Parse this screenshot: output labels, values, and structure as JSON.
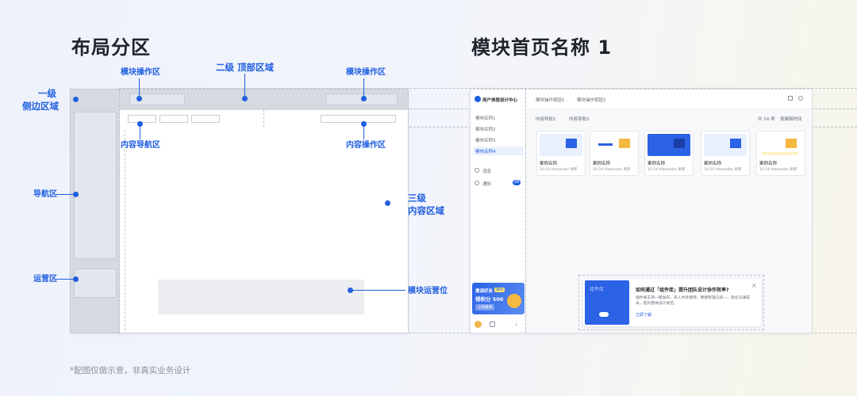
{
  "titles": {
    "layout": "布局分区",
    "module_home": "模块首页名称 1"
  },
  "labels": {
    "level1_a": "一级",
    "level1_b": "侧边区域",
    "level2": "二级 顶部区域",
    "level3_a": "三级",
    "level3_b": "内容区域",
    "module_ops_left": "模块操作区",
    "module_ops_right": "模块操作区",
    "content_nav": "内容导航区",
    "content_ops": "内容操作区",
    "nav_area": "导航区",
    "ops_area": "运营区",
    "module_ops_slot": "模块运营位"
  },
  "footnote": "*配图仅做示意，非真实业务设计",
  "mock": {
    "workspace": "用户体验设计中心",
    "top_tabs": [
      "模块操作按钮1",
      "模块操作按钮2"
    ],
    "sub_tabs": [
      "内容导航1",
      "内容导航2"
    ],
    "sort_items": [
      "共 24 项",
      "按编辑时间"
    ],
    "sidebar_items": [
      "模块名称1",
      "模块名称2",
      "模块名称3",
      "模块名称4"
    ],
    "sidebar_links": [
      "消息",
      "通知"
    ],
    "badge": "99",
    "promo_line1": "邀请好友",
    "promo_tag": "限时",
    "promo_line2": "得积分 500",
    "promo_btn": "立即邀请",
    "cards": [
      {
        "name": "案例名称",
        "meta": "10:24 Alexander 更新"
      },
      {
        "name": "案例名称",
        "meta": "10:24 Alexander 更新"
      },
      {
        "name": "案例名称",
        "meta": "10:24 Alexander 更新"
      },
      {
        "name": "案例名称",
        "meta": "10:24 Alexander 更新"
      },
      {
        "name": "案例名称",
        "meta": "10:24 Alexander 更新"
      }
    ],
    "tip_title": "如何通过「组件库」提升团队设计协作效率?",
    "tip_body": "组件库支持一键发布、多人共享使用，便捷管理与统一，简化沟通成本，提升整体设计规范。",
    "tip_link": "立即了解",
    "tip_banner": "组件库"
  },
  "colors": {
    "accent": "#1f5fe0",
    "sidebar_gray": "#d5d9e0",
    "wire_border": "#c7ccd6"
  }
}
